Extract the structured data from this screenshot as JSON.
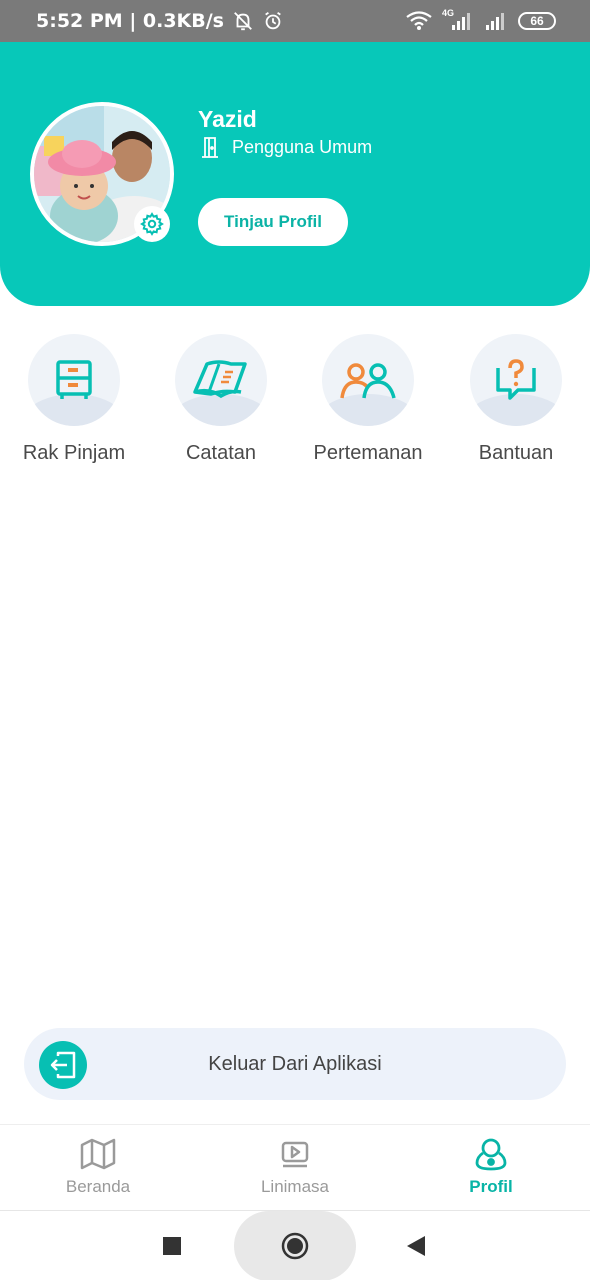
{
  "status_bar": {
    "time_speed": "5:52 PM | 0.3KB/s",
    "network_type": "4G",
    "battery": "66",
    "icons": [
      "alarm-off-icon",
      "alarm-clock-icon",
      "wifi-icon",
      "signal-icon",
      "battery-icon"
    ]
  },
  "profile": {
    "name": "Yazid",
    "role": "Pengguna Umum",
    "review_button": "Tinjau Profil"
  },
  "menu": [
    {
      "label": "Rak Pinjam",
      "icon": "shelf-icon"
    },
    {
      "label": "Catatan",
      "icon": "book-icon"
    },
    {
      "label": "Pertemanan",
      "icon": "friends-icon"
    },
    {
      "label": "Bantuan",
      "icon": "help-chat-icon"
    }
  ],
  "logout": {
    "label": "Keluar Dari Aplikasi",
    "icon": "logout-icon"
  },
  "bottom_nav": [
    {
      "label": "Beranda",
      "icon": "map-icon",
      "active": false
    },
    {
      "label": "Linimasa",
      "icon": "video-timeline-icon",
      "active": false
    },
    {
      "label": "Profil",
      "icon": "profile-icon",
      "active": true
    }
  ],
  "colors": {
    "accent": "#07c8b9",
    "orange": "#f08a3c",
    "menu_bg": "#eff3f8",
    "logout_bg": "#edf2fa"
  }
}
